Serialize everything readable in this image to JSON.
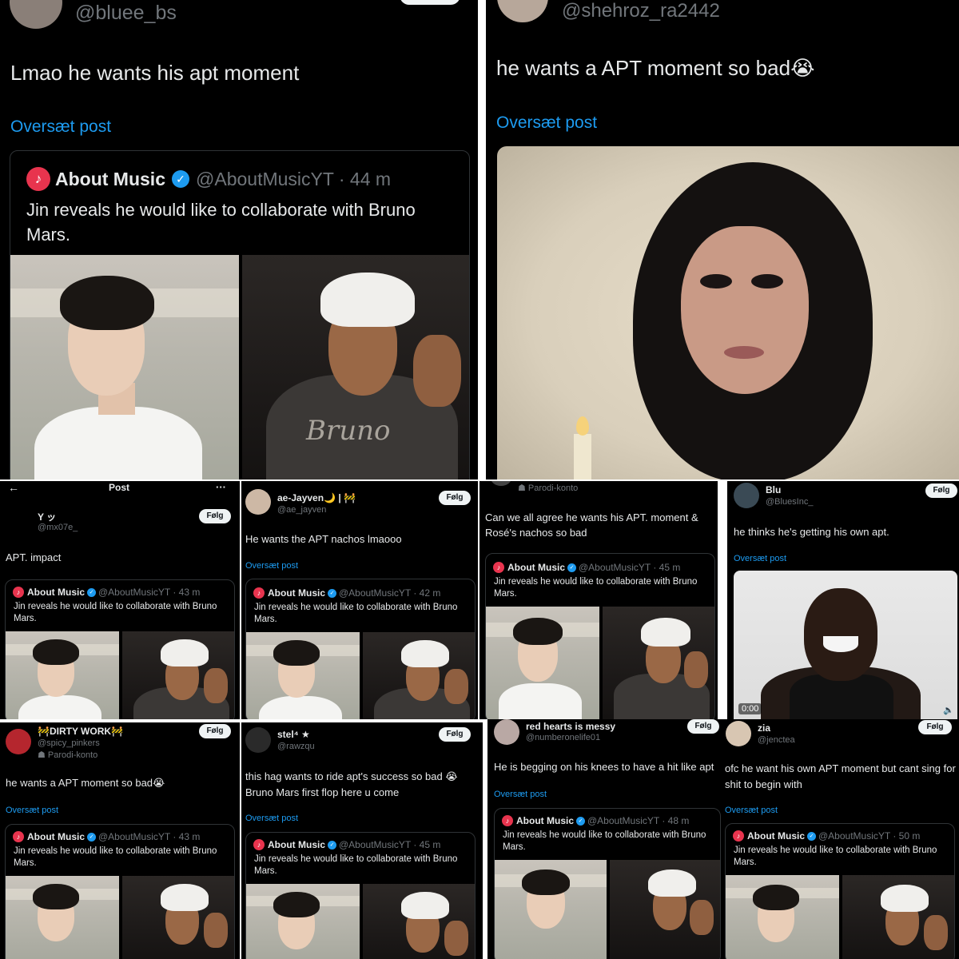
{
  "panels": {
    "p1": {
      "handle": "@bluee_bs",
      "text": "Lmao he wants his apt moment",
      "translate": "Oversæt post",
      "quote": {
        "name": "About Music",
        "handle_time": "@AboutMusicYT · 44 m",
        "text": "Jin reveals he would like to collaborate with Bruno Mars."
      }
    },
    "p2": {
      "handle": "@shehroz_ra2442",
      "text": "he wants a APT moment so bad😭",
      "translate": "Oversæt post"
    },
    "p3": {
      "nav_title": "Post",
      "nav_more": "···",
      "nav_back": "←",
      "name": "Y ッ",
      "handle": "@mx07e_",
      "follow": "Følg",
      "text": "APT. impact",
      "quote": {
        "name": "About Music",
        "handle_time": "@AboutMusicYT · 43 m",
        "text": "Jin reveals he would like to collaborate with Bruno Mars."
      }
    },
    "p4": {
      "name": "ae-Jayven🌙 | 🚧",
      "handle": "@ae_jayven",
      "follow": "Følg",
      "text": "He wants the APT nachos lmaooo",
      "translate": "Oversæt post",
      "quote": {
        "name": "About Music",
        "handle_time": "@AboutMusicYT · 42 m",
        "text": "Jin reveals he would like to collaborate with Bruno Mars."
      }
    },
    "p5": {
      "parody": "Parodi-konto",
      "text": "Can we all agree he wants his APT. moment & Rosé's nachos so bad",
      "quote": {
        "name": "About Music",
        "handle_time": "@AboutMusicYT · 45 m",
        "text": "Jin reveals he would like to collaborate with Bruno Mars."
      }
    },
    "p6": {
      "name": "Blu",
      "handle": "@BluesInc_",
      "follow": "Følg",
      "text": "he thinks he's getting his own apt.",
      "translate": "Oversæt post",
      "video_time": "0:00",
      "volume_icon": "🔈"
    },
    "p7": {
      "name": "🚧DIRTY WORK🚧",
      "handle": "@spicy_pinkers",
      "parody": "Parodi-konto",
      "follow": "Følg",
      "text": "he wants a APT moment so bad😭",
      "translate": "Oversæt post",
      "quote": {
        "name": "About Music",
        "handle_time": "@AboutMusicYT · 43 m",
        "text": "Jin reveals he would like to collaborate with Bruno Mars."
      }
    },
    "p8": {
      "name": "stel⁴ ★",
      "handle": "@rawzqu",
      "follow": "Følg",
      "text": "this hag wants to ride apt's success so bad 😭 Bruno Mars first flop here u come",
      "translate": "Oversæt post",
      "quote": {
        "name": "About Music",
        "handle_time": "@AboutMusicYT · 45 m",
        "text": "Jin reveals he would like to collaborate with Bruno Mars."
      }
    },
    "p9": {
      "name": "red hearts is messy",
      "handle": "@numberonelife01",
      "follow": "Følg",
      "text": "He is begging on his knees to have a hit like apt",
      "translate": "Oversæt post",
      "quote": {
        "name": "About Music",
        "handle_time": "@AboutMusicYT · 48 m",
        "text": "Jin reveals he would like to collaborate with Bruno Mars."
      }
    },
    "p10": {
      "name": "zia",
      "handle": "@jenctea",
      "follow": "Følg",
      "text": "ofc he want his own APT moment but cant sing for shit to begin with",
      "translate": "Oversæt post",
      "quote": {
        "name": "About Music",
        "handle_time": "@AboutMusicYT · 50 m",
        "text": "Jin reveals he would like to collaborate with Bruno Mars."
      }
    }
  },
  "icons": {
    "music_logo": "music-note-icon",
    "verified": "verified-badge-icon",
    "parody": "parody-mask-icon",
    "back": "back-arrow-icon",
    "more": "more-icon"
  },
  "colors": {
    "background": "#000000",
    "text": "#e7e9ea",
    "muted": "#71767b",
    "link": "#1d9bf0",
    "divider": "#ffffff",
    "follow_bg": "#eff3f4"
  }
}
